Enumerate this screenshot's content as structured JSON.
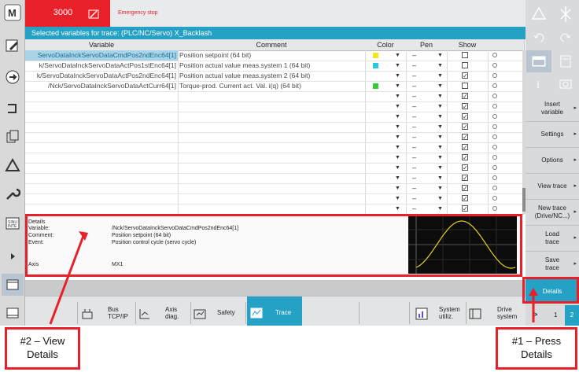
{
  "alarm": {
    "number": "3000",
    "text": "Emergency stop"
  },
  "title": "Selected variables for trace:  (PLC/NC/Servo) X_Backlash",
  "table": {
    "headers": [
      "Variable",
      "Comment",
      "Color",
      "Pen",
      "Show"
    ],
    "rows": [
      {
        "variable": "ServoDataInckServoDataCmdPos2ndEnc64[1]",
        "comment": "Position setpoint (64 bit)",
        "color": "#f2e51c",
        "pen": "–",
        "show": false,
        "selected": true
      },
      {
        "variable": "k/ServoDataInckServoDataActPos1stEnc64[1]",
        "comment": "Position actual value meas.system 1 (64 bit)",
        "color": "#28c8e0",
        "pen": "–",
        "show": false
      },
      {
        "variable": "k/ServoDataInckServoDataActPos2ndEnc64[1]",
        "comment": "Position actual value meas.system 2 (64 bit)",
        "color": "#ffffff",
        "pen": "–",
        "show": true
      },
      {
        "variable": "/Nck/ServoDataInckServoDataActCurr64[1]",
        "comment": "Torque-prod. Current act. Val. i(q) (64 bit)",
        "color": "#33cc33",
        "pen": "–",
        "show": false
      },
      {
        "variable": "",
        "comment": "",
        "color": "#ffffff",
        "pen": "–",
        "show": true
      },
      {
        "variable": "",
        "comment": "",
        "color": "#ffffff",
        "pen": "–",
        "show": true
      },
      {
        "variable": "",
        "comment": "",
        "color": "#ffffff",
        "pen": "–",
        "show": true
      },
      {
        "variable": "",
        "comment": "",
        "color": "#ffffff",
        "pen": "–",
        "show": true
      },
      {
        "variable": "",
        "comment": "",
        "color": "#ffffff",
        "pen": "–",
        "show": true
      },
      {
        "variable": "",
        "comment": "",
        "color": "#ffffff",
        "pen": "–",
        "show": true
      },
      {
        "variable": "",
        "comment": "",
        "color": "#ffffff",
        "pen": "–",
        "show": true
      },
      {
        "variable": "",
        "comment": "",
        "color": "#ffffff",
        "pen": "–",
        "show": true
      },
      {
        "variable": "",
        "comment": "",
        "color": "#ffffff",
        "pen": "–",
        "show": true
      },
      {
        "variable": "",
        "comment": "",
        "color": "#ffffff",
        "pen": "–",
        "show": true
      },
      {
        "variable": "",
        "comment": "",
        "color": "#ffffff",
        "pen": "–",
        "show": true
      },
      {
        "variable": "",
        "comment": "",
        "color": "#ffffff",
        "pen": "–",
        "show": true
      }
    ]
  },
  "details": {
    "heading": "Details",
    "variable_label": "Variable:",
    "variable_value": "/Nck/ServoDataInckServoDataCmdPos2ndEnc64[1]",
    "comment_label": "Comment:",
    "comment_value": "Position setpoint (64 bit)",
    "event_label": "Event:",
    "event_value": "Position control cycle (servo cycle)",
    "axis_label": "Axis",
    "axis_value": "MX1"
  },
  "bottom_tabs": [
    {
      "label": "Bus\nTCP/IP",
      "icon": "bus-icon"
    },
    {
      "label": "Axis\ndiag.",
      "icon": "axis-diag-icon"
    },
    {
      "label": "Safety",
      "icon": "safety-icon"
    },
    {
      "label": "Trace",
      "icon": "trace-icon",
      "active": true
    },
    {
      "label": "System\nutiliz.",
      "icon": "system-utilization-icon"
    },
    {
      "label": "Drive\nsystem",
      "icon": "drive-system-icon"
    }
  ],
  "pagination": {
    "arrow": ">",
    "pages": [
      "1",
      "2"
    ],
    "current": "2"
  },
  "right_softkeys": [
    {
      "label": "Insert\nvariable",
      "arrow": "▸"
    },
    {
      "label": "Settings",
      "arrow": "▸"
    },
    {
      "label": "Options",
      "arrow": "▸"
    },
    {
      "label": "View trace",
      "arrow": "▸"
    },
    {
      "label": "New trace\n(Drive/NC...)",
      "arrow": "▸"
    },
    {
      "label": "Load\ntrace",
      "arrow": "▸"
    },
    {
      "label": "Save\ntrace",
      "arrow": "▸"
    },
    {
      "label": "Details",
      "arrow": ""
    }
  ],
  "right_top_icons": [
    "axis-icon",
    "settings-icon",
    "undo-icon",
    "redo-icon",
    "window-icon",
    "calculator-icon",
    "info-icon",
    "camera-icon"
  ],
  "left_icons": [
    "m-logo-icon",
    "edit-icon",
    "circle-arrow-icon",
    "plug-icon",
    "copy-icon",
    "triangle-icon",
    "wrench-icon",
    "sinumerik-icon",
    "expand-icon",
    "window-icon",
    "window-bottom-icon"
  ],
  "annotations": {
    "view_details": "#2 – View\nDetails",
    "press_details": "#1 – Press\nDetails"
  },
  "colors": {
    "accent": "#25a1c6",
    "alarm": "#e8202a",
    "details_button": "#25a1c6"
  }
}
